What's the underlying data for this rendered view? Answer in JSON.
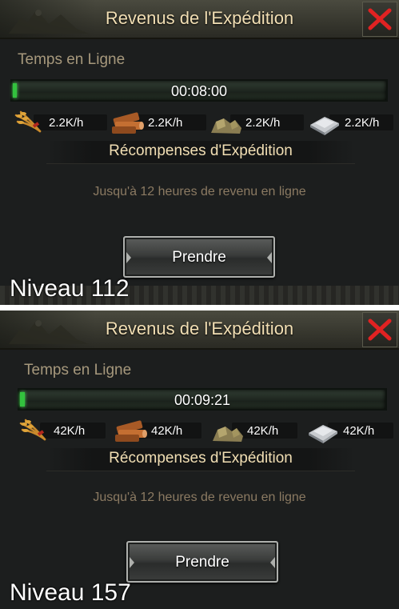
{
  "colors": {
    "panel_bg": "#1c1e1e",
    "title_text": "#f2dfb4",
    "progress_fill": "#33c13e",
    "close_x": "#e12222",
    "note_text": "#8b7a62"
  },
  "panels": [
    {
      "title": "Revenus de l'Expédition",
      "subtitle": "Temps en Ligne",
      "timer": "00:08:00",
      "progress_fraction": 0.01,
      "resources": [
        {
          "icon": "wheat-icon",
          "rate": "2.2K/h"
        },
        {
          "icon": "wood-icon",
          "rate": "2.2K/h"
        },
        {
          "icon": "stone-icon",
          "rate": "2.2K/h"
        },
        {
          "icon": "iron-icon",
          "rate": "2.2K/h"
        }
      ],
      "rewards_heading": "Récompenses d'Expédition",
      "note": "Jusqu'à 12 heures de revenu en ligne",
      "button_label": "Prendre",
      "level_label": "Niveau 112"
    },
    {
      "title": "Revenus de l'Expédition",
      "subtitle": "Temps en Ligne",
      "timer": "00:09:21",
      "progress_fraction": 0.013,
      "resources": [
        {
          "icon": "wheat-icon",
          "rate": "42K/h"
        },
        {
          "icon": "wood-icon",
          "rate": "42K/h"
        },
        {
          "icon": "stone-icon",
          "rate": "42K/h"
        },
        {
          "icon": "iron-icon",
          "rate": "42K/h"
        }
      ],
      "rewards_heading": "Récompenses d'Expédition",
      "note": "Jusqu'à 12 heures de revenu en ligne",
      "button_label": "Prendre",
      "level_label": "Niveau 157"
    }
  ]
}
